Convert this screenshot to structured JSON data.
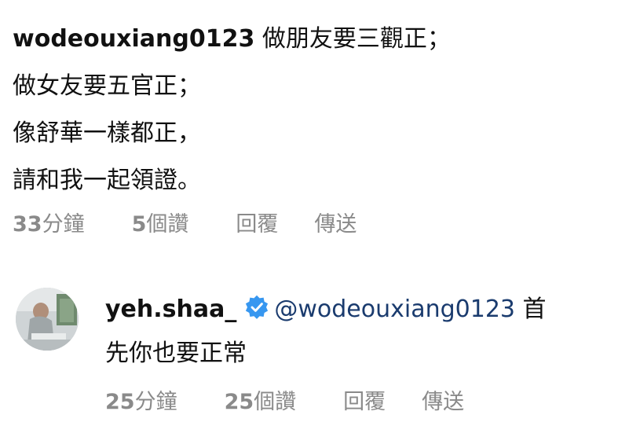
{
  "comment1": {
    "username": "wodeouxiang0123",
    "lines": [
      "做朋友要三觀正；",
      "做女友要五官正；",
      "像舒華一樣都正，",
      "請和我一起領證。"
    ],
    "time_num": "33",
    "time_unit": "分鐘",
    "likes_num": "5",
    "likes_unit": "個讚",
    "reply_label": "回覆",
    "share_label": "傳送"
  },
  "comment2": {
    "username": "yeh.shaa_",
    "verified": true,
    "mention": "@wodeouxiang0123",
    "text_line1_tail": "首",
    "text_line2": "先你也要正常",
    "time_num": "25",
    "time_unit": "分鐘",
    "likes_num": "25",
    "likes_unit": "個讚",
    "reply_label": "回覆",
    "share_label": "傳送"
  },
  "colors": {
    "text": "#111111",
    "meta": "#8a8a8a",
    "mention": "#1a3b6e",
    "verified": "#3797f0"
  }
}
